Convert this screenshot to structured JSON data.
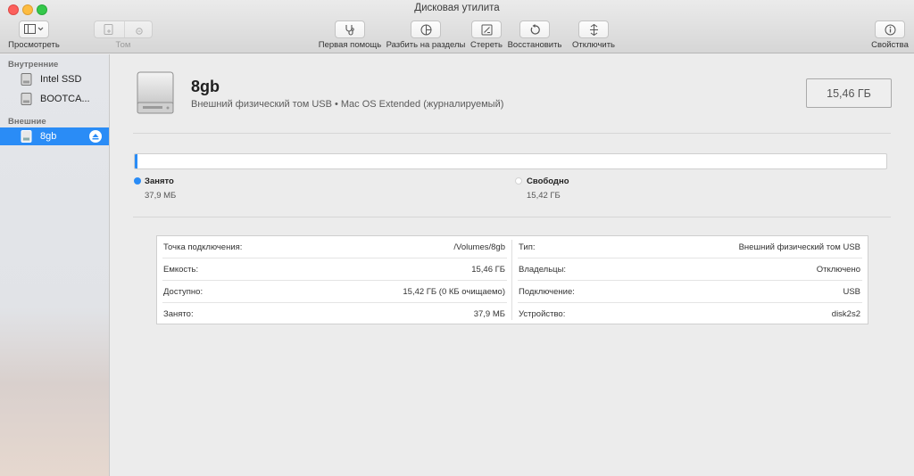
{
  "window": {
    "title": "Дисковая утилита"
  },
  "toolbar": {
    "view_label": "Просмотреть",
    "volume_label": "Том",
    "first_aid_label": "Первая помощь",
    "partition_label": "Разбить на разделы",
    "erase_label": "Стереть",
    "restore_label": "Восстановить",
    "unmount_label": "Отключить",
    "info_label": "Свойства"
  },
  "sidebar": {
    "internal_header": "Внутренние",
    "external_header": "Внешние",
    "items": [
      {
        "label": "Intel SSD",
        "section": "internal"
      },
      {
        "label": "BOOTCA...",
        "section": "internal"
      },
      {
        "label": "8gb",
        "section": "external",
        "selected": true
      }
    ]
  },
  "disk": {
    "name": "8gb",
    "description": "Внешний физический том USB • Mac OS Extended (журналируемый)",
    "capacity": "15,46 ГБ"
  },
  "usage": {
    "used_fraction": 0.0024,
    "used_color": "#2a8cf6",
    "used_title": "Занято",
    "used_value": "37,9 МБ",
    "free_title": "Свободно",
    "free_value": "15,42 ГБ"
  },
  "info": {
    "left": [
      {
        "key": "Точка подключения:",
        "value": "/Volumes/8gb"
      },
      {
        "key": "Емкость:",
        "value": "15,46 ГБ"
      },
      {
        "key": "Доступно:",
        "value": "15,42 ГБ (0 КБ очищаемо)"
      },
      {
        "key": "Занято:",
        "value": "37,9 МБ"
      }
    ],
    "right": [
      {
        "key": "Тип:",
        "value": "Внешний физический том USB"
      },
      {
        "key": "Владельцы:",
        "value": "Отключено"
      },
      {
        "key": "Подключение:",
        "value": "USB"
      },
      {
        "key": "Устройство:",
        "value": "disk2s2"
      }
    ]
  },
  "colors": {
    "accent": "#2a8cf6",
    "sidebar_selection": "#2a8cf6"
  }
}
